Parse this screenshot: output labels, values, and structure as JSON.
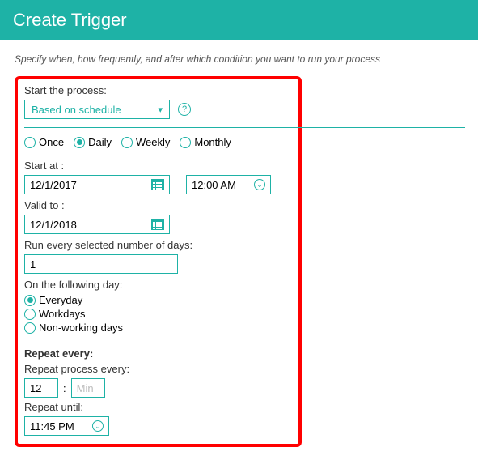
{
  "header": {
    "title": "Create Trigger"
  },
  "subtitle": "Specify when, how frequently, and after which condition you want to run your process",
  "start_process": {
    "label": "Start the process:",
    "selected": "Based on schedule"
  },
  "frequency": {
    "options": [
      "Once",
      "Daily",
      "Weekly",
      "Monthly"
    ],
    "selected": "Daily"
  },
  "start_at": {
    "label": "Start at :",
    "date": "12/1/2017",
    "time": "12:00 AM"
  },
  "valid_to": {
    "label": "Valid to :",
    "date": "12/1/2018"
  },
  "run_every": {
    "label": "Run every selected number of days:",
    "value": "1"
  },
  "following_day": {
    "label": "On the following day:",
    "options": [
      "Everyday",
      "Workdays",
      "Non-working days"
    ],
    "selected": "Everyday"
  },
  "repeat": {
    "heading": "Repeat every:",
    "process_label": "Repeat process every:",
    "value": "12",
    "colon": ":",
    "min_placeholder": "Min",
    "until_label": "Repeat until:",
    "until_value": "11:45 PM"
  }
}
